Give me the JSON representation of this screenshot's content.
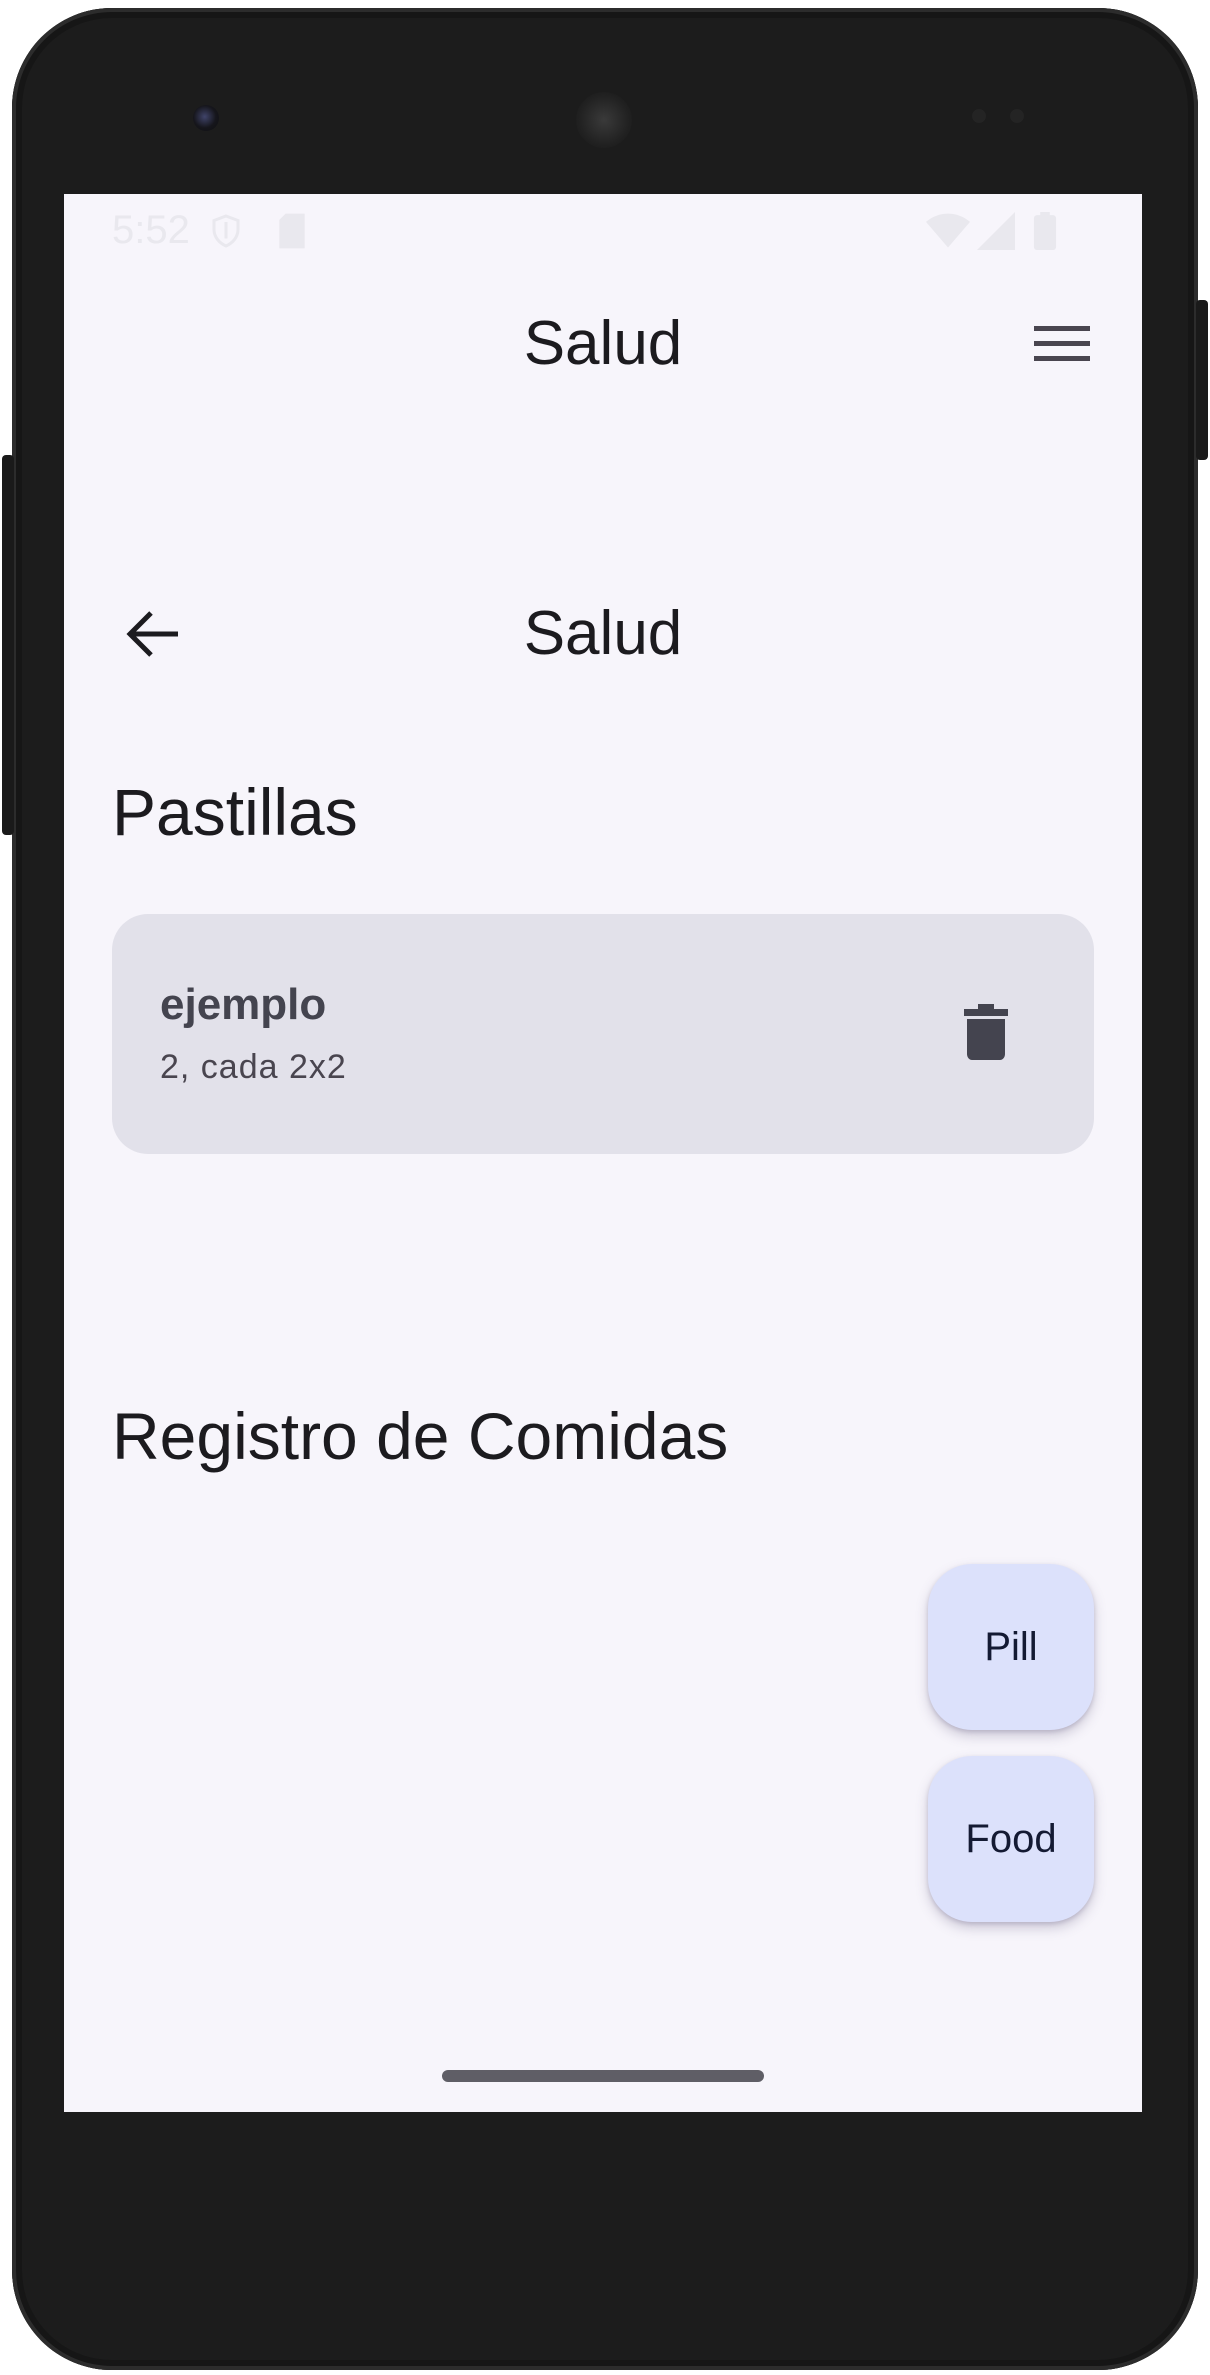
{
  "status_bar": {
    "time": "5:52"
  },
  "app_bar": {
    "title": "Salud",
    "menu_icon": "menu-icon"
  },
  "sub_bar": {
    "title": "Salud",
    "back_icon": "arrow-back-icon"
  },
  "pills_section": {
    "heading": "Pastillas",
    "items": [
      {
        "name": "ejemplo",
        "dose": "2, cada 2x2",
        "delete_icon": "trash-icon"
      }
    ]
  },
  "food_section": {
    "heading": "Registro de Comidas"
  },
  "fabs": {
    "pill_label": "Pill",
    "food_label": "Food"
  },
  "colors": {
    "background": "#f7f5fb",
    "card": "#e2e1ea",
    "fab": "#dce1fb",
    "text_primary": "#1c1b1f"
  }
}
